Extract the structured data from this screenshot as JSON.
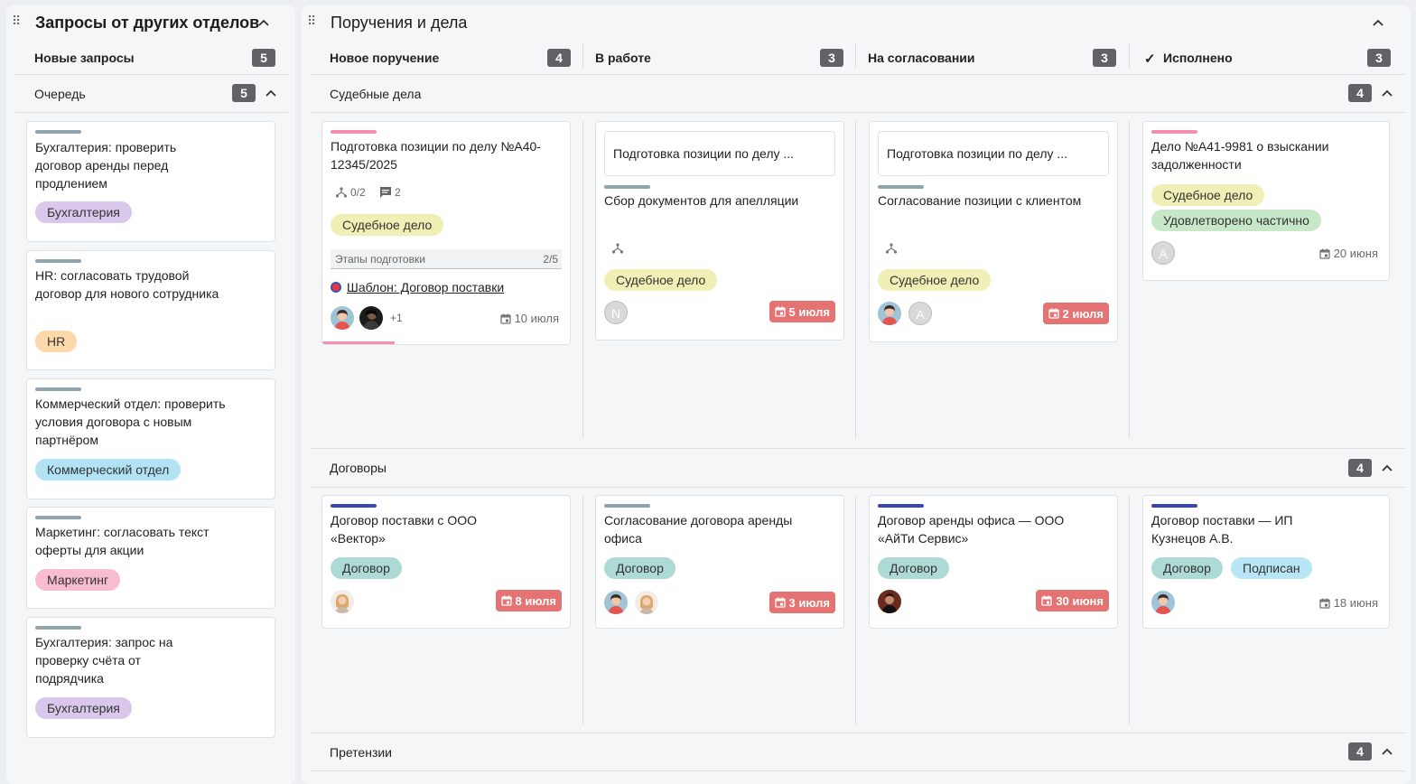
{
  "left_panel": {
    "title": "Запросы от других отделов",
    "new_requests": {
      "label": "Новые запросы",
      "count": "5"
    },
    "queue": {
      "label": "Очередь",
      "count": "5"
    },
    "cards": [
      {
        "title": "Бухгалтерия: проверить договор аренды перед продлением",
        "tag": "Бухгалтерия"
      },
      {
        "title": "HR: согласовать трудовой договор для нового сотрудника",
        "tag": "HR"
      },
      {
        "title": "Коммерческий отдел: проверить условия договора с новым партнёром",
        "tag": "Коммерческий отдел"
      },
      {
        "title": "Маркетинг: согласовать текст оферты для акции",
        "tag": "Маркетинг"
      },
      {
        "title": "Бухгалтерия: запрос на проверку счёта от подрядчика",
        "tag": "Бухгалтерия"
      }
    ]
  },
  "right_panel": {
    "title": "Поручения и дела",
    "columns": [
      {
        "label": "Новое поручение",
        "count": "4"
      },
      {
        "label": "В работе",
        "count": "3"
      },
      {
        "label": "На согласовании",
        "count": "3"
      },
      {
        "label": "Исполнено",
        "count": "3"
      }
    ],
    "sections": [
      {
        "title": "Судебные дела",
        "count": "4",
        "cards": [
          {
            "title": "Подготовка позиции по делу №А40-12345/2025",
            "subtasks": "0/2",
            "comments": "2",
            "tag": "Судебное дело",
            "stages_label": "Этапы подготовки",
            "stages_value": "2/5",
            "template_link": "Шаблон: Договор поставки",
            "extra_assignees": "+1",
            "date": "10 июля"
          },
          {
            "parent": "Подготовка позиции по делу ...",
            "title": "Сбор документов для апелляции",
            "tag": "Судебное дело",
            "avatar": "N",
            "date": "5 июля"
          },
          {
            "parent": "Подготовка позиции по делу ...",
            "title": "Согласование позиции с клиентом",
            "tag": "Судебное дело",
            "avatar": "A",
            "date": "2 июля"
          },
          {
            "title": "Дело №А41-9981 о взыскании задолженности",
            "tag": "Судебное дело",
            "tag2": "Удовлетворено частично",
            "avatar": "A",
            "date": "20 июня"
          }
        ]
      },
      {
        "title": "Договоры",
        "count": "4",
        "cards": [
          {
            "title": "Договор поставки с ООО «Вектор»",
            "tag": "Договор",
            "date": "8 июля"
          },
          {
            "title": "Согласование договора аренды офиса",
            "tag": "Договор",
            "date": "3 июля"
          },
          {
            "title": "Договор аренды офиса — ООО «АйТи Сервис»",
            "tag": "Договор",
            "date": "30 июня"
          },
          {
            "title": "Договор поставки — ИП Кузнецов А.В.",
            "tag": "Договор",
            "tag2": "Подписан",
            "date": "18 июня"
          }
        ]
      },
      {
        "title": "Претензии",
        "count": "4"
      }
    ]
  },
  "colors": {
    "pink": "#f48fb1",
    "gray": "#90a4ae",
    "navy": "#3949ab",
    "red_date": "#e57373",
    "badge": "#5f6368"
  }
}
